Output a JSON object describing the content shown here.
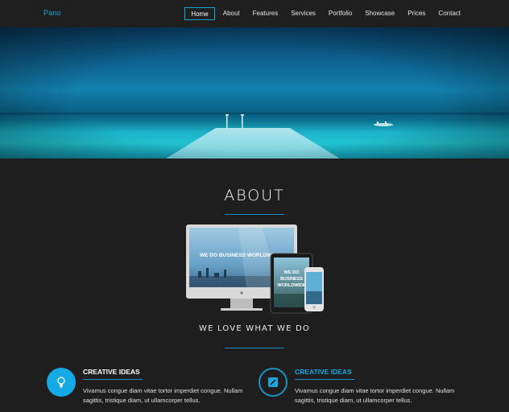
{
  "nav": {
    "brand": "Pano",
    "items": [
      {
        "label": "Home",
        "active": true
      },
      {
        "label": "About"
      },
      {
        "label": "Features"
      },
      {
        "label": "Services"
      },
      {
        "label": "Portfolio"
      },
      {
        "label": "Showcase"
      },
      {
        "label": "Prices"
      },
      {
        "label": "Contact"
      }
    ]
  },
  "about": {
    "title": "ABOUT",
    "tagline": "WE LOVE WHAT WE DO",
    "device_screen_text": {
      "desktop": "WE DO BUSINESS WORLDWIDE",
      "tablet": [
        "WE DO",
        "BUSINESS",
        "WORLDWIDE"
      ]
    }
  },
  "features": [
    {
      "title": "CREATIVE IDEAS",
      "text": "Vivamus congue diam vitae tortor imperdiet congue. Nullam sagittis, tristique diam, ut ullamcorper tellus.",
      "icon": "lightbulb-icon"
    },
    {
      "title": "CREATIVE IDEAS",
      "text": "Vivamus congue diam vitae tortor imperdiet congue. Nullam sagittis, tristique diam, ut ullamcorper tellus.",
      "icon": "edit-icon"
    }
  ],
  "colors": {
    "accent": "#17a2d8",
    "background": "#1e1e1e"
  }
}
